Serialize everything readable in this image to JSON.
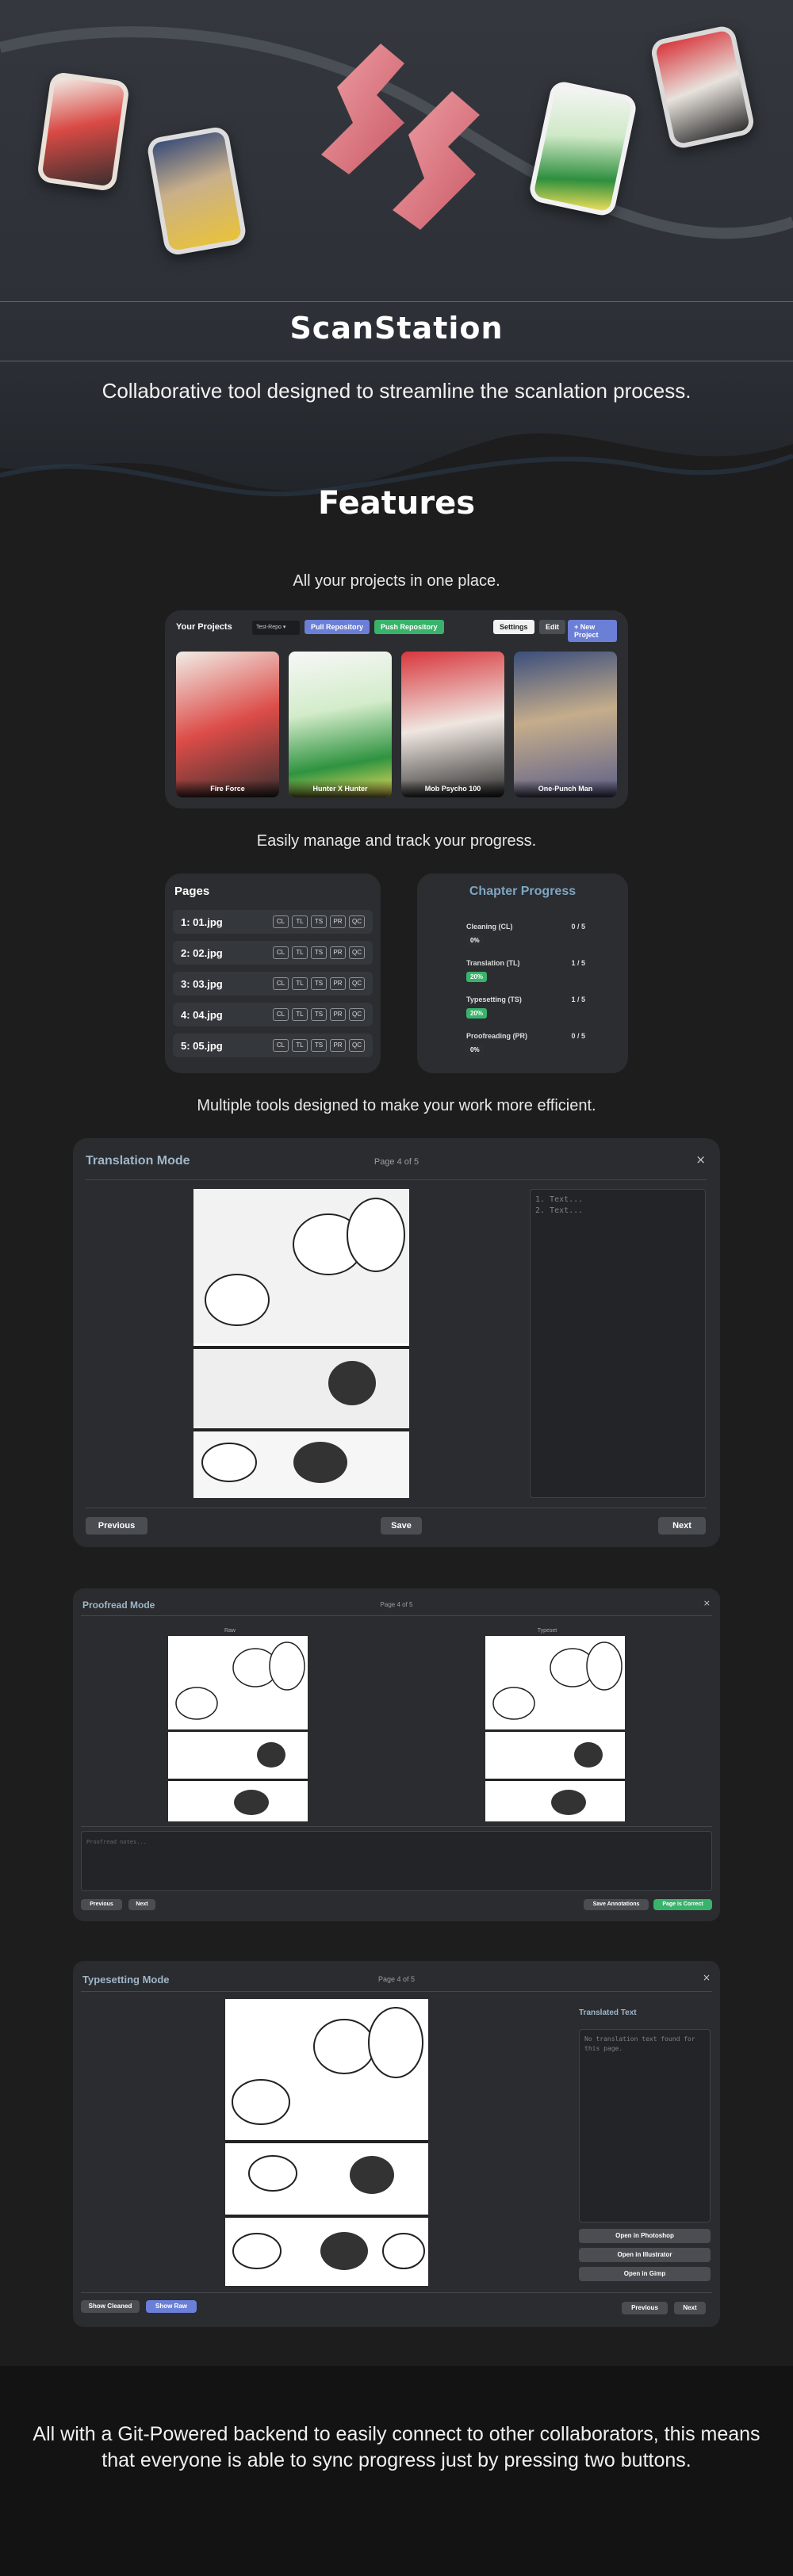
{
  "hero": {
    "title": "ScanStation",
    "subtitle": "Collaborative tool designed to streamline the scanlation process."
  },
  "features": {
    "title": "Features",
    "caption_projects": "All your projects in one place.",
    "caption_progress": "Easily manage and track your progress.",
    "caption_tools": "Multiple tools designed to make your work more efficient."
  },
  "projects": {
    "title": "Your Projects",
    "select_value": "Test-Repo",
    "pull_label": "Pull Repository",
    "push_label": "Push Repository",
    "settings_label": "Settings",
    "edit_label": "Edit",
    "new_label": "+ New Project",
    "cards": [
      {
        "name": "Fire Force"
      },
      {
        "name": "Hunter X Hunter"
      },
      {
        "name": "Mob Psycho 100"
      },
      {
        "name": "One-Punch Man"
      }
    ]
  },
  "pages": {
    "title": "Pages",
    "tags": [
      "CL",
      "TL",
      "TS",
      "PR",
      "QC"
    ],
    "rows": [
      "1: 01.jpg",
      "2: 02.jpg",
      "3: 03.jpg",
      "4: 04.jpg",
      "5: 05.jpg"
    ]
  },
  "chapter_progress": {
    "title": "Chapter Progress",
    "items": [
      {
        "label": "Cleaning (CL)",
        "count": "0 / 5",
        "percent": "0%",
        "color": "#2d2f32"
      },
      {
        "label": "Translation (TL)",
        "count": "1 / 5",
        "percent": "20%",
        "color": "#39b36b"
      },
      {
        "label": "Typesetting (TS)",
        "count": "1 / 5",
        "percent": "20%",
        "color": "#39b36b"
      },
      {
        "label": "Proofreading (PR)",
        "count": "0 / 5",
        "percent": "0%",
        "color": "#2d2f32"
      }
    ]
  },
  "translation_mode": {
    "title": "Translation Mode",
    "page": "Page 4 of 5",
    "close": "×",
    "textarea": "1. Text...\n2. Text...",
    "prev": "Previous",
    "save": "Save",
    "next": "Next"
  },
  "proofread_mode": {
    "title": "Proofread Mode",
    "page": "Page 4 of 5",
    "close": "×",
    "left_label": "Raw",
    "right_label": "Typeset",
    "placeholder": "Proofread notes...",
    "prev": "Previous",
    "next": "Next",
    "save_annotations": "Save Annotations",
    "page_correct": "Page is Correct"
  },
  "typesetting_mode": {
    "title": "Typesetting Mode",
    "page": "Page 4 of 5",
    "close": "×",
    "translated_title": "Translated Text",
    "textarea": "No translation text found for\nthis page.",
    "open_ps": "Open in Photoshop",
    "open_ai": "Open in Illustrator",
    "open_gimp": "Open in Gimp",
    "show_cleaned": "Show Cleaned",
    "show_raw": "Show Raw",
    "prev": "Previous",
    "next": "Next"
  },
  "footer": {
    "text": "All with a Git-Powered backend to easily connect to other collaborators, this means that everyone is able to sync progress just by pressing two buttons."
  },
  "colors": {
    "accent_blue": "#6b7fd7",
    "accent_green": "#39b36b",
    "logo_pink": "#e07c86"
  }
}
